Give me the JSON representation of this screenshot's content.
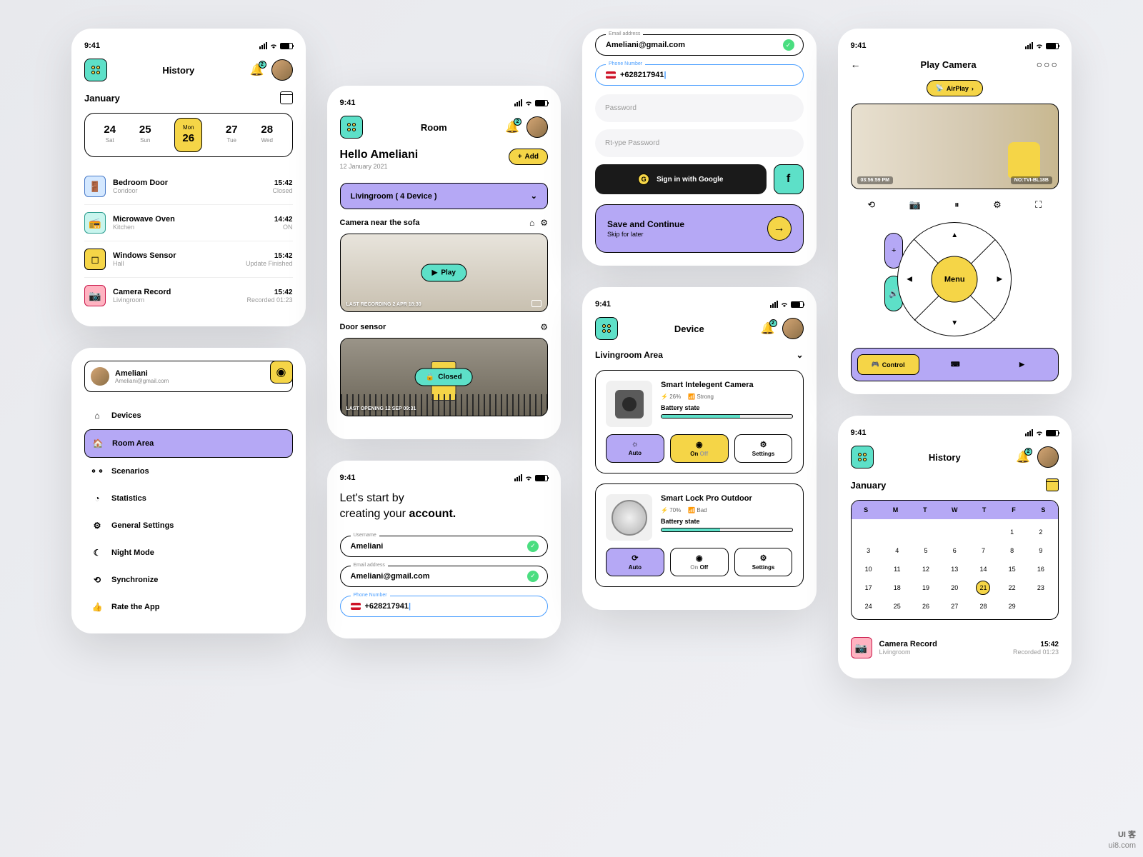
{
  "status_time": "9:41",
  "notif_count": "2",
  "history1": {
    "title": "History",
    "month": "January",
    "days": [
      {
        "num": "24",
        "name": "Sat"
      },
      {
        "num": "25",
        "name": "Sun"
      },
      {
        "name": "Mon",
        "num": "26"
      },
      {
        "num": "27",
        "name": "Tue"
      },
      {
        "num": "28",
        "name": "Wed"
      }
    ],
    "items": [
      {
        "title": "Bedroom  Door",
        "sub": "Coridoor",
        "time": "15:42",
        "status": "Closed"
      },
      {
        "title": "Microwave Oven",
        "sub": "Kitchen",
        "time": "14:42",
        "status": "ON"
      },
      {
        "title": "Windows Sensor",
        "sub": "Hall",
        "time": "15:42",
        "status": "Update Finished"
      },
      {
        "title": "Camera Record",
        "sub": "Livingroom",
        "time": "15:42",
        "status": "Recorded 01:23"
      }
    ]
  },
  "menu": {
    "profile_name": "Ameliani",
    "profile_email": "Ameliani@gmail.com",
    "items": [
      "Devices",
      "Room Area",
      "Scenarios",
      "Statistics",
      "General Settings",
      "Night Mode",
      "Synchronize",
      "Rate the App"
    ]
  },
  "room": {
    "title": "Room",
    "greeting": "Hello Ameliani",
    "date": "12 January 2021",
    "add": "Add",
    "select": "Livingroom ( 4 Device )",
    "cam1_title": "Camera near the sofa",
    "cam1_play": "Play",
    "cam1_footer": "LAST RECORDING 2 APR 18:30",
    "cam2_title": "Door sensor",
    "cam2_status": "Closed",
    "cam2_footer": "LAST OPENING 12 SEP 09:31"
  },
  "signup": {
    "title_1": "Let's start by",
    "title_2": "creating your ",
    "title_3": "account.",
    "username_label": "Username",
    "username": "Ameliani",
    "email_label": "Email address",
    "email": "Ameliani@gmail.com",
    "phone_label": "Phone Number",
    "phone": "+628217941",
    "password": "Password",
    "retype": "Rt-ype Password",
    "google": "Sign in with Google",
    "save": "Save and Continue",
    "skip": "Skip for later"
  },
  "device": {
    "title": "Device",
    "area": "Livingroom Area",
    "d1_name": "Smart Intelegent Camera",
    "d1_batt": "26%",
    "d1_signal": "Strong",
    "d1_batt_label": "Battery state",
    "d2_name": "Smart Lock Pro Outdoor",
    "d2_batt": "70%",
    "d2_signal": "Bad",
    "d2_batt_label": "Battery state",
    "auto": "Auto",
    "on": "On",
    "off": "Off",
    "settings": "Settings"
  },
  "camera": {
    "title": "Play Camera",
    "airplay": "AirPlay",
    "time": "03:56:59 PM",
    "id": "NO:TVI-BL18B",
    "menu": "Menu",
    "control": "Control"
  },
  "history2": {
    "title": "History",
    "month": "January",
    "days": [
      "S",
      "M",
      "T",
      "W",
      "T",
      "F",
      "S"
    ],
    "today": "21",
    "record_title": "Camera Record",
    "record_sub": "Livingroom",
    "record_time": "15:42",
    "record_status": "Recorded 01:23"
  }
}
